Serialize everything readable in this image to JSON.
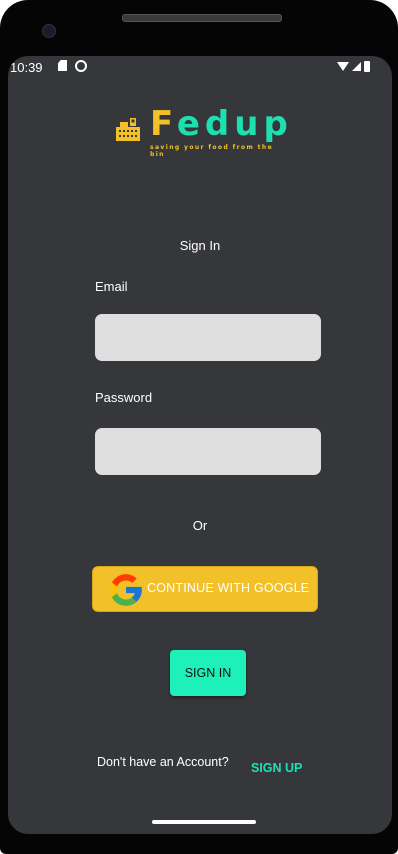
{
  "status_bar": {
    "time": "10:39"
  },
  "brand": {
    "name_first": "F",
    "name_rest": "edup",
    "tagline": "saving your food from the bin",
    "colors": {
      "primary": "#1ce0b0",
      "accent": "#f2c12a",
      "background": "#36373a"
    }
  },
  "form": {
    "title": "Sign In",
    "email_label": "Email",
    "email_value": "",
    "password_label": "Password",
    "password_value": "",
    "or_text": "Or"
  },
  "google_button": {
    "label": "CONTINUE WITH GOOGLE",
    "icon": "google-icon"
  },
  "signin_button": {
    "label": "SIGN IN"
  },
  "footer": {
    "prompt": "Don't have an Account?",
    "signup_label": "SIGN UP"
  }
}
